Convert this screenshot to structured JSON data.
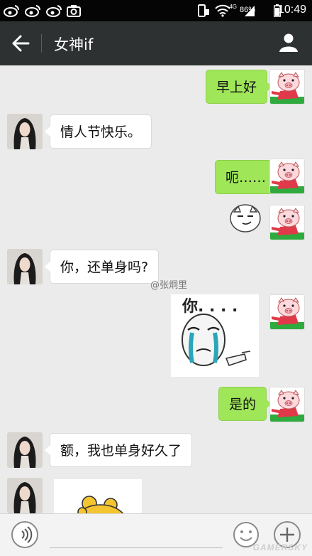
{
  "status_bar": {
    "network": "4G",
    "battery": "86%",
    "time": "10:49",
    "left_icons": [
      "weibo-icon",
      "weibo-icon",
      "weibo-icon",
      "camera-icon"
    ],
    "right_icons": [
      "phone-vibrate-icon",
      "wifi-icon",
      "signal-icon",
      "battery-icon"
    ]
  },
  "header": {
    "title": "女神if",
    "back_icon": "arrow-left-icon",
    "profile_icon": "person-icon"
  },
  "messages": [
    {
      "sender": "me",
      "type": "text",
      "text": "早上好"
    },
    {
      "sender": "other",
      "type": "text",
      "text": "情人节快乐。"
    },
    {
      "sender": "me",
      "type": "text",
      "text": "呃……"
    },
    {
      "sender": "me",
      "type": "sticker",
      "sticker": "smirk-face-sticker"
    },
    {
      "sender": "other",
      "type": "text",
      "text": "你，还单身吗?"
    },
    {
      "sender": "me",
      "type": "sticker",
      "sticker": "crying-face-sticker",
      "caption": "你. . . ."
    },
    {
      "sender": "me",
      "type": "text",
      "text": "是的"
    },
    {
      "sender": "other",
      "type": "text",
      "text": "额，我也单身好久了"
    },
    {
      "sender": "other",
      "type": "sticker",
      "sticker": "yellow-bear-sticker"
    }
  ],
  "watermark": "@张炯里",
  "input_bar": {
    "placeholder": "",
    "voice_icon": "voice-icon",
    "emoji_icon": "emoji-icon",
    "plus_icon": "plus-icon"
  },
  "site_watermark": "GAMERSKY",
  "colors": {
    "status_bar": "#050505",
    "header": "#2e3132",
    "background": "#ebebeb",
    "my_bubble": "#9fe658",
    "their_bubble": "#ffffff"
  }
}
